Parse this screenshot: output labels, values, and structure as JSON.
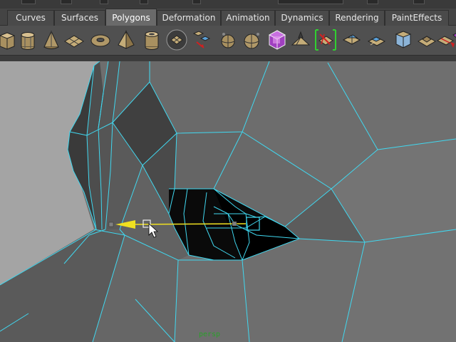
{
  "shelf": {
    "tabs": [
      {
        "label": "Curves"
      },
      {
        "label": "Surfaces"
      },
      {
        "label": "Polygons",
        "active": true
      },
      {
        "label": "Deformation"
      },
      {
        "label": "Animation"
      },
      {
        "label": "Dynamics"
      },
      {
        "label": "Rendering"
      },
      {
        "label": "PaintEffects"
      }
    ],
    "tools": [
      {
        "name": "poly-cube-icon"
      },
      {
        "name": "poly-cylinder-icon"
      },
      {
        "name": "poly-cone-icon"
      },
      {
        "name": "poly-plane-icon"
      },
      {
        "name": "poly-torus-icon"
      },
      {
        "name": "poly-pyramid-icon"
      },
      {
        "name": "poly-pipe-icon"
      },
      {
        "name": "combine-icon"
      },
      {
        "name": "separate-icon"
      },
      {
        "name": "extract-icon"
      },
      {
        "name": "smooth-icon"
      },
      {
        "name": "boolean-union-icon"
      },
      {
        "name": "boolean-difference-icon"
      },
      {
        "name": "average-vertices-icon"
      },
      {
        "name": "split-polygon-icon"
      },
      {
        "name": "interactive-split-icon"
      },
      {
        "name": "extrude-face-icon"
      },
      {
        "name": "bevel-icon"
      },
      {
        "name": "wedge-face-icon"
      },
      {
        "name": "merge-vertices-icon"
      },
      {
        "name": "cut-faces-icon"
      }
    ]
  },
  "viewport": {
    "camera": "persp",
    "wire_color": "#40d8f0",
    "manipulator_color": "#f0e020"
  }
}
